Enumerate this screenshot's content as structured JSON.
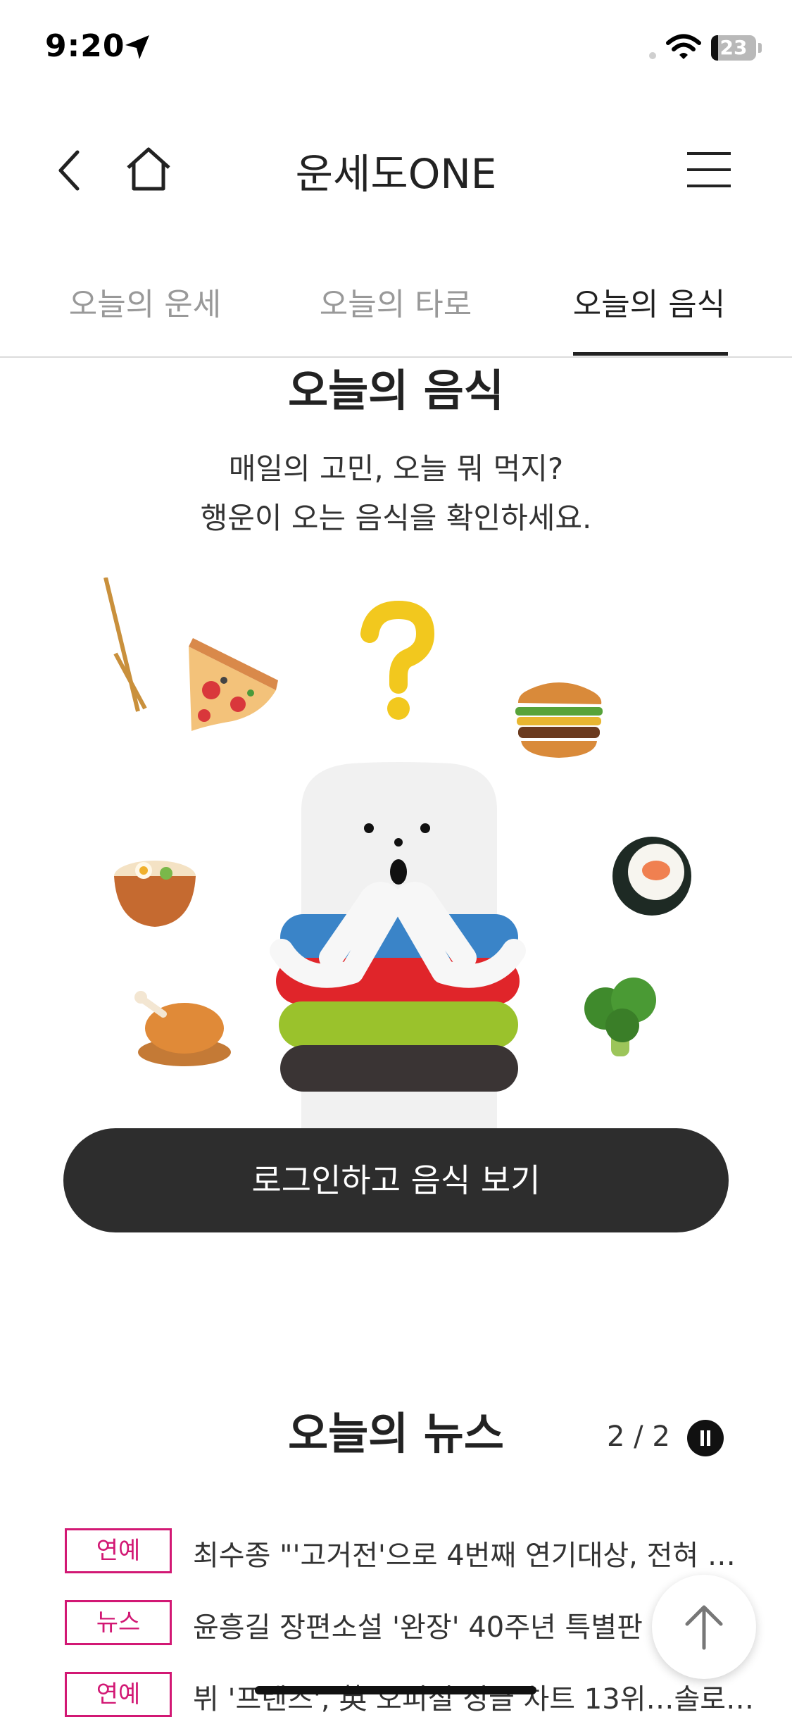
{
  "status_bar": {
    "time": "9:20",
    "battery_level": "23"
  },
  "header": {
    "title": "운세도ONE"
  },
  "tabs": [
    {
      "label": "오늘의 운세",
      "active": false
    },
    {
      "label": "오늘의 타로",
      "active": false
    },
    {
      "label": "오늘의 음식",
      "active": true
    }
  ],
  "food": {
    "title": "오늘의 음식",
    "desc_line1": "매일의 고민, 오늘 뭐 먹지?",
    "desc_line2": "행운이 오는 음식을 확인하세요.",
    "cta": "로그인하고 음식 보기"
  },
  "news": {
    "title": "오늘의 뉴스",
    "page": "2 / 2",
    "items": [
      {
        "badge": "연예",
        "text": "최수종 \"'고거전'으로 4번째 연기대상, 전혀 …"
      },
      {
        "badge": "뉴스",
        "text": "윤흥길 장편소설 '완장' 40주년 특별판 출…"
      },
      {
        "badge": "연예",
        "text": "뷔 '프렌즈', 英 오피셜 싱글 차트 13위…솔로…"
      }
    ]
  },
  "colors": {
    "accent": "#d21874",
    "button_bg": "#2d2d2d",
    "text": "#222222"
  }
}
